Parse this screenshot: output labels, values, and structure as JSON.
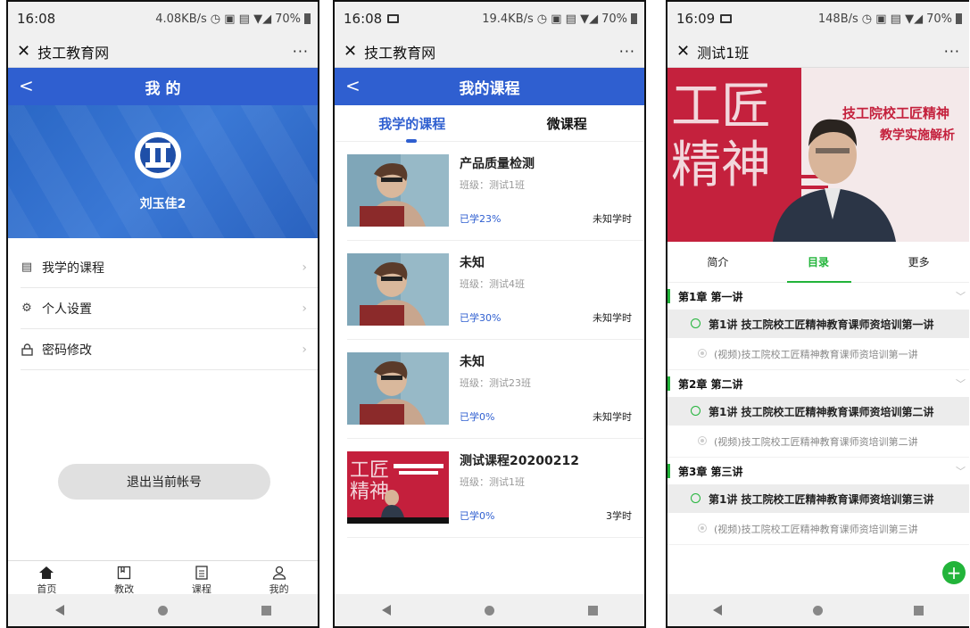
{
  "phone1": {
    "status": {
      "time": "16:08",
      "speed": "4.08KB/s",
      "battery": "70%"
    },
    "title": "技工教育网",
    "more": "···",
    "header": "我 的",
    "back": "<",
    "username": "刘玉佳2",
    "menu": [
      {
        "label": "我学的课程",
        "icon": "list-icon"
      },
      {
        "label": "个人设置",
        "icon": "gear-icon"
      },
      {
        "label": "密码修改",
        "icon": "lock-icon"
      }
    ],
    "logout": "退出当前帐号",
    "tabs": [
      {
        "label": "首页",
        "icon": "home-icon"
      },
      {
        "label": "教改",
        "icon": "book-icon"
      },
      {
        "label": "课程",
        "icon": "document-icon"
      },
      {
        "label": "我的",
        "icon": "person-icon"
      }
    ]
  },
  "phone2": {
    "status": {
      "time": "16:08",
      "speed": "19.4KB/s",
      "battery": "70%"
    },
    "title": "技工教育网",
    "more": "···",
    "header": "我的课程",
    "back": "<",
    "segments": [
      "我学的课程",
      "微课程"
    ],
    "courses": [
      {
        "title": "产品质量检测",
        "class": "班级：测试1班",
        "progress": "已学23%",
        "hours": "未知学时"
      },
      {
        "title": "未知",
        "class": "班级：测试4班",
        "progress": "已学30%",
        "hours": "未知学时"
      },
      {
        "title": "未知",
        "class": "班级：测试23班",
        "progress": "已学0%",
        "hours": "未知学时"
      },
      {
        "title": "测试课程20200212",
        "class": "班级：测试1班",
        "progress": "已学0%",
        "hours": "3学时"
      }
    ]
  },
  "phone3": {
    "status": {
      "time": "16:09",
      "speed": "148B/s",
      "battery": "70%"
    },
    "title": "测试1班",
    "more": "···",
    "video_text": {
      "big1": "工匠",
      "big2": "精神",
      "line1": "技工院校工匠精神",
      "line2": "教学实施解析"
    },
    "tabs": [
      "简介",
      "目录",
      "更多"
    ],
    "chapters": [
      {
        "title": "第1章  第一讲",
        "lesson": "第1讲 技工院校工匠精神教育课师资培训第一讲",
        "sub": "(视频)技工院校工匠精神教育课师资培训第一讲"
      },
      {
        "title": "第2章  第二讲",
        "lesson": "第1讲 技工院校工匠精神教育课师资培训第二讲",
        "sub": "(视频)技工院校工匠精神教育课师资培训第二讲"
      },
      {
        "title": "第3章  第三讲",
        "lesson": "第1讲 技工院校工匠精神教育课师资培训第三讲",
        "sub": "(视频)技工院校工匠精神教育课师资培训第三讲"
      }
    ]
  },
  "colors": {
    "blue": "#2f5fd0",
    "green": "#22b43a"
  }
}
